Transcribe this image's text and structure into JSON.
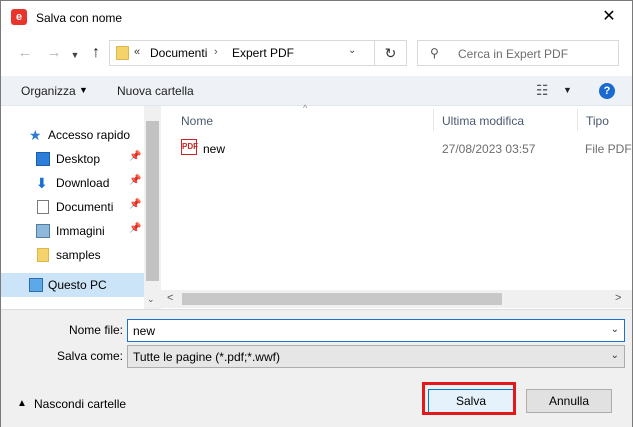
{
  "window": {
    "title": "Salva con nome",
    "app_icon_letter": "e",
    "close_symbol": "✕"
  },
  "nav": {
    "back_symbol": "←",
    "forward_symbol": "→",
    "up_symbol": "↑",
    "address": {
      "overflow_symbol": "«",
      "segment1": "Documenti",
      "separator": "›",
      "segment2": "Expert PDF",
      "dropdown_symbol": "⌄",
      "refresh_symbol": "↻"
    },
    "search": {
      "icon_symbol": "⚲",
      "placeholder": "Cerca in Expert PDF"
    }
  },
  "toolbar": {
    "organize_label": "Organizza",
    "organize_arrow": "▼",
    "new_folder_label": "Nuova cartella",
    "view_symbol": "☷",
    "view_dd_symbol": "▼",
    "help_symbol": "?"
  },
  "sidebar": {
    "items": [
      {
        "label": "Accesso rapido",
        "icon": "quick-access-star-icon",
        "pinned": false
      },
      {
        "label": "Desktop",
        "icon": "desktop-icon",
        "pinned": true
      },
      {
        "label": "Download",
        "icon": "download-arrow-icon",
        "pinned": true
      },
      {
        "label": "Documenti",
        "icon": "documents-icon",
        "pinned": true
      },
      {
        "label": "Immagini",
        "icon": "pictures-icon",
        "pinned": true
      },
      {
        "label": "samples",
        "icon": "folder-icon",
        "pinned": false
      },
      {
        "label": "Questo PC",
        "icon": "this-pc-icon",
        "pinned": false
      }
    ],
    "pin_symbol": "📌",
    "star_symbol": "★",
    "down_symbol": "⬇",
    "scroll_down_symbol": "⌄"
  },
  "file_list": {
    "sort_indicator": "^",
    "columns": [
      "Nome",
      "Ultima modifica",
      "Tipo"
    ],
    "rows": [
      {
        "name": "new",
        "modified": "27/08/2023 03:57",
        "type": "File PDF",
        "icon": "pdf-file-icon",
        "icon_text": "PDF"
      }
    ],
    "scroll_left_symbol": "<",
    "scroll_right_symbol": ">"
  },
  "form": {
    "filename_label": "Nome file:",
    "filename_value": "new",
    "savetype_label": "Salva come:",
    "savetype_value": "Tutte le pagine (*.pdf;*.wwf)",
    "dropdown_symbol": "⌄"
  },
  "footer": {
    "hide_folders_label": "Nascondi cartelle",
    "hide_folders_arrow": "▲",
    "save_label": "Salva",
    "cancel_label": "Annulla"
  },
  "colors": {
    "accent": "#0078d7",
    "highlight_box": "#e3181b",
    "selected_bg": "#cce4f7",
    "app_icon": "#e8342a"
  }
}
